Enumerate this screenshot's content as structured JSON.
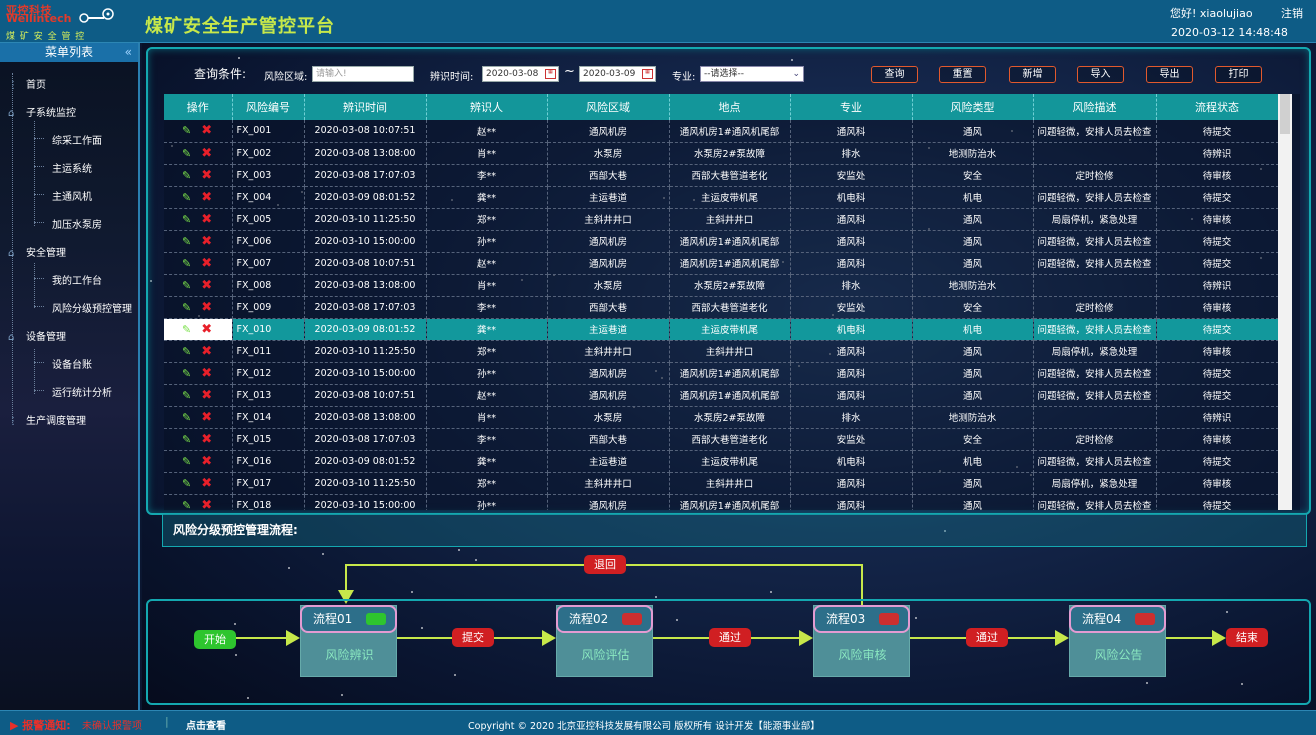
{
  "header": {
    "logo_line1": "亚控科技",
    "logo_line2": "Wellintech",
    "logo_line3": "煤 矿 安 全 管 控",
    "title": "煤矿安全生产管控平台",
    "greeting": "您好! xiaolujiao",
    "logout": "注销",
    "datetime": "2020-03-12 14:48:48"
  },
  "sidebar": {
    "title": "菜单列表",
    "collapse": "«",
    "items": [
      {
        "label": "首页"
      },
      {
        "label": "子系统监控"
      },
      {
        "label": "综采工作面"
      },
      {
        "label": "主运系统"
      },
      {
        "label": "主通风机"
      },
      {
        "label": "加压水泵房"
      },
      {
        "label": "安全管理"
      },
      {
        "label": "我的工作台"
      },
      {
        "label": "风险分级预控管理"
      },
      {
        "label": "设备管理"
      },
      {
        "label": "设备台账"
      },
      {
        "label": "运行统计分析"
      },
      {
        "label": "生产调度管理"
      }
    ]
  },
  "query": {
    "title": "查询条件:",
    "area_label": "风险区域:",
    "area_placeholder": "请输入!",
    "time_label": "辨识时间:",
    "date_from": "2020-03-08",
    "tilde": "~",
    "date_to": "2020-03-09",
    "major_label": "专业:",
    "major_value": "--请选择--",
    "buttons": [
      "查询",
      "重置",
      "新增",
      "导入",
      "导出",
      "打印"
    ]
  },
  "table": {
    "columns": [
      "操作",
      "风险编号",
      "辨识时间",
      "辨识人",
      "风险区域",
      "地点",
      "专业",
      "风险类型",
      "风险描述",
      "流程状态"
    ],
    "rows": [
      [
        "FX_001",
        "2020-03-08 10:07:51",
        "赵**",
        "通风机房",
        "通风机房1#通风机尾部",
        "通风科",
        "通风",
        "问题轻微，安排人员去检查",
        "待提交"
      ],
      [
        "FX_002",
        "2020-03-08 13:08:00",
        "肖**",
        "水泵房",
        "水泵房2#泵故障",
        "排水",
        "地测防治水",
        "",
        "待辨识"
      ],
      [
        "FX_003",
        "2020-03-08 17:07:03",
        "李**",
        "西部大巷",
        "西部大巷管道老化",
        "安监处",
        "安全",
        "定时检修",
        "待审核"
      ],
      [
        "FX_004",
        "2020-03-09 08:01:52",
        "龚**",
        "主运巷道",
        "主运皮带机尾",
        "机电科",
        "机电",
        "问题轻微，安排人员去检查",
        "待提交"
      ],
      [
        "FX_005",
        "2020-03-10 11:25:50",
        "郑**",
        "主斜井井口",
        "主斜井井口",
        "通风科",
        "通风",
        "局扇停机，紧急处理",
        "待审核"
      ],
      [
        "FX_006",
        "2020-03-10 15:00:00",
        "孙**",
        "通风机房",
        "通风机房1#通风机尾部",
        "通风科",
        "通风",
        "问题轻微，安排人员去检查",
        "待提交"
      ],
      [
        "FX_007",
        "2020-03-08 10:07:51",
        "赵**",
        "通风机房",
        "通风机房1#通风机尾部",
        "通风科",
        "通风",
        "问题轻微，安排人员去检查",
        "待提交"
      ],
      [
        "FX_008",
        "2020-03-08 13:08:00",
        "肖**",
        "水泵房",
        "水泵房2#泵故障",
        "排水",
        "地测防治水",
        "",
        "待辨识"
      ],
      [
        "FX_009",
        "2020-03-08 17:07:03",
        "李**",
        "西部大巷",
        "西部大巷管道老化",
        "安监处",
        "安全",
        "定时检修",
        "待审核"
      ],
      [
        "FX_010",
        "2020-03-09 08:01:52",
        "龚**",
        "主运巷道",
        "主运皮带机尾",
        "机电科",
        "机电",
        "问题轻微，安排人员去检查",
        "待提交"
      ],
      [
        "FX_011",
        "2020-03-10 11:25:50",
        "郑**",
        "主斜井井口",
        "主斜井井口",
        "通风科",
        "通风",
        "局扇停机，紧急处理",
        "待审核"
      ],
      [
        "FX_012",
        "2020-03-10 15:00:00",
        "孙**",
        "通风机房",
        "通风机房1#通风机尾部",
        "通风科",
        "通风",
        "问题轻微，安排人员去检查",
        "待提交"
      ],
      [
        "FX_013",
        "2020-03-08 10:07:51",
        "赵**",
        "通风机房",
        "通风机房1#通风机尾部",
        "通风科",
        "通风",
        "问题轻微，安排人员去检查",
        "待提交"
      ],
      [
        "FX_014",
        "2020-03-08 13:08:00",
        "肖**",
        "水泵房",
        "水泵房2#泵故障",
        "排水",
        "地测防治水",
        "",
        "待辨识"
      ],
      [
        "FX_015",
        "2020-03-08 17:07:03",
        "李**",
        "西部大巷",
        "西部大巷管道老化",
        "安监处",
        "安全",
        "定时检修",
        "待审核"
      ],
      [
        "FX_016",
        "2020-03-09 08:01:52",
        "龚**",
        "主运巷道",
        "主运皮带机尾",
        "机电科",
        "机电",
        "问题轻微，安排人员去检查",
        "待提交"
      ],
      [
        "FX_017",
        "2020-03-10 11:25:50",
        "郑**",
        "主斜井井口",
        "主斜井井口",
        "通风科",
        "通风",
        "局扇停机，紧急处理",
        "待审核"
      ],
      [
        "FX_018",
        "2020-03-10 15:00:00",
        "孙**",
        "通风机房",
        "通风机房1#通风机尾部",
        "通风科",
        "通风",
        "问题轻微，安排人员去检查",
        "待提交"
      ]
    ],
    "selected_index": 9
  },
  "flow": {
    "title": "风险分级预控管理流程:",
    "start": "开始",
    "end": "结束",
    "back": "退回",
    "nodes": [
      {
        "label": "流程01",
        "name": "风险辨识",
        "status_color": "#2ec52e"
      },
      {
        "label": "流程02",
        "name": "风险评估",
        "status_color": "#cc2f2f"
      },
      {
        "label": "流程03",
        "name": "风险审核",
        "status_color": "#cc2f2f"
      },
      {
        "label": "流程04",
        "name": "风险公告",
        "status_color": "#cc2f2f"
      }
    ],
    "links": [
      "提交",
      "通过",
      "通过"
    ]
  },
  "footer": {
    "alarm_label": "▶ 报警通知:",
    "alarm_value": "未确认报警项",
    "check": "点击查看",
    "copyright": "Copyright © 2020 北京亚控科技发展有限公司 版权所有 设计开发【能源事业部】"
  },
  "colors": {
    "header_bg": "#0e5c86",
    "accent": "#13969a",
    "title": "#c7e84a",
    "alarm": "#e8302a"
  }
}
